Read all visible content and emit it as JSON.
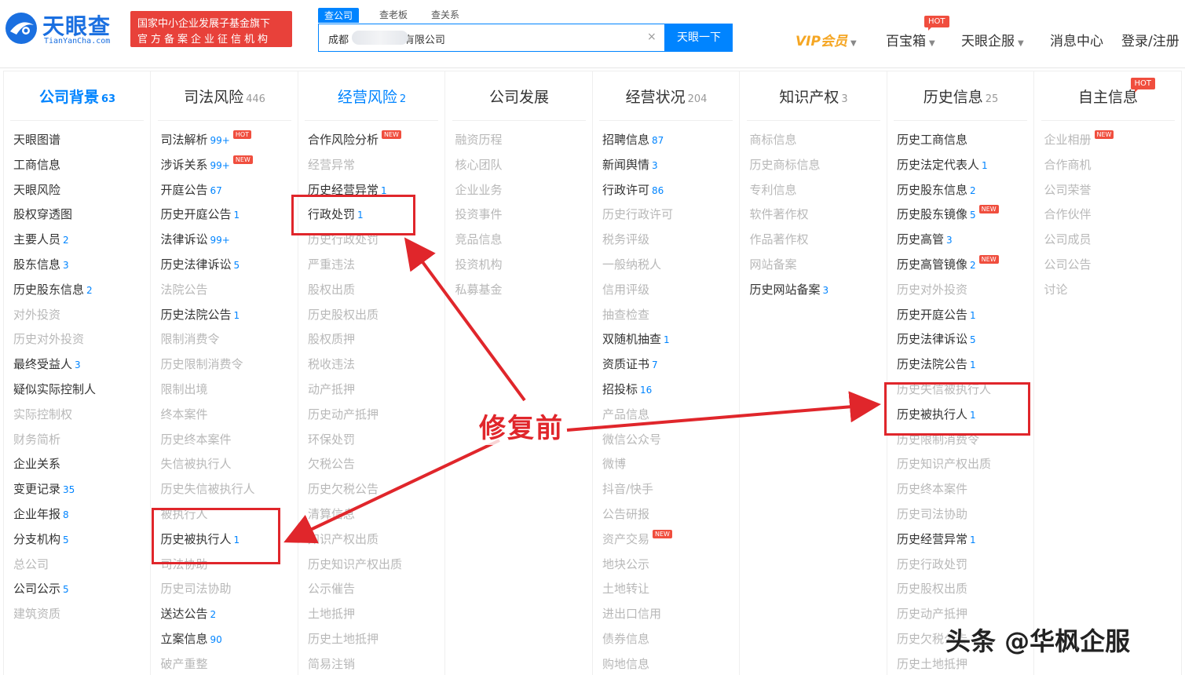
{
  "header": {
    "logo_text": "天眼查",
    "logo_sub": "TianYanCha.com",
    "badge_line1": "国家中小企业发展子基金旗下",
    "badge_line2": "官方备案企业征信机构",
    "search_tabs": [
      "查公司",
      "查老板",
      "查关系"
    ],
    "search_value": "成都              务有限公司",
    "search_button": "天眼一下",
    "clear_icon": "×",
    "nav": {
      "vip": "VIP会员",
      "treasure": "百宝箱",
      "treasure_hot": "HOT",
      "enterprise_service": "天眼企服",
      "messages": "消息中心",
      "login": "登录/注册"
    }
  },
  "columns": [
    {
      "title": "公司背景",
      "count": "63",
      "highlight": true,
      "bold": true,
      "items": [
        {
          "label": "天眼图谱",
          "on": true
        },
        {
          "label": "工商信息",
          "on": true
        },
        {
          "label": "天眼风险",
          "on": true
        },
        {
          "label": "股权穿透图",
          "on": true
        },
        {
          "label": "主要人员",
          "on": true,
          "count": "2"
        },
        {
          "label": "股东信息",
          "on": true,
          "count": "3"
        },
        {
          "label": "历史股东信息",
          "on": true,
          "count": "2"
        },
        {
          "label": "对外投资",
          "on": false
        },
        {
          "label": "历史对外投资",
          "on": false
        },
        {
          "label": "最终受益人",
          "on": true,
          "count": "3"
        },
        {
          "label": "疑似实际控制人",
          "on": true
        },
        {
          "label": "实际控制权",
          "on": false
        },
        {
          "label": "财务简析",
          "on": false
        },
        {
          "label": "企业关系",
          "on": true
        },
        {
          "label": "变更记录",
          "on": true,
          "count": "35"
        },
        {
          "label": "企业年报",
          "on": true,
          "count": "8"
        },
        {
          "label": "分支机构",
          "on": true,
          "count": "5"
        },
        {
          "label": "总公司",
          "on": false
        },
        {
          "label": "公司公示",
          "on": true,
          "count": "5"
        },
        {
          "label": "建筑资质",
          "on": false
        }
      ]
    },
    {
      "title": "司法风险",
      "count": "446",
      "highlight": false,
      "items": [
        {
          "label": "司法解析",
          "on": true,
          "count": "99+",
          "tag": "HOT"
        },
        {
          "label": "涉诉关系",
          "on": true,
          "count": "99+",
          "tag": "NEW"
        },
        {
          "label": "开庭公告",
          "on": true,
          "count": "67"
        },
        {
          "label": "历史开庭公告",
          "on": true,
          "count": "1"
        },
        {
          "label": "法律诉讼",
          "on": true,
          "count": "99+"
        },
        {
          "label": "历史法律诉讼",
          "on": true,
          "count": "5"
        },
        {
          "label": "法院公告",
          "on": false
        },
        {
          "label": "历史法院公告",
          "on": true,
          "count": "1"
        },
        {
          "label": "限制消费令",
          "on": false
        },
        {
          "label": "历史限制消费令",
          "on": false
        },
        {
          "label": "限制出境",
          "on": false
        },
        {
          "label": "终本案件",
          "on": false
        },
        {
          "label": "历史终本案件",
          "on": false
        },
        {
          "label": "失信被执行人",
          "on": false
        },
        {
          "label": "历史失信被执行人",
          "on": false
        },
        {
          "label": "被执行人",
          "on": false
        },
        {
          "label": "历史被执行人",
          "on": true,
          "count": "1"
        },
        {
          "label": "司法协助",
          "on": false
        },
        {
          "label": "历史司法协助",
          "on": false
        },
        {
          "label": "送达公告",
          "on": true,
          "count": "2"
        },
        {
          "label": "立案信息",
          "on": true,
          "count": "90"
        },
        {
          "label": "破产重整",
          "on": false
        }
      ]
    },
    {
      "title": "经营风险",
      "count": "2",
      "highlight": true,
      "items": [
        {
          "label": "合作风险分析",
          "on": true,
          "tag": "NEW"
        },
        {
          "label": "经营异常",
          "on": false
        },
        {
          "label": "历史经营异常",
          "on": true,
          "count": "1"
        },
        {
          "label": "行政处罚",
          "on": true,
          "count": "1"
        },
        {
          "label": "历史行政处罚",
          "on": false
        },
        {
          "label": "严重违法",
          "on": false
        },
        {
          "label": "股权出质",
          "on": false
        },
        {
          "label": "历史股权出质",
          "on": false
        },
        {
          "label": "股权质押",
          "on": false
        },
        {
          "label": "税收违法",
          "on": false
        },
        {
          "label": "动产抵押",
          "on": false
        },
        {
          "label": "历史动产抵押",
          "on": false
        },
        {
          "label": "环保处罚",
          "on": false
        },
        {
          "label": "欠税公告",
          "on": false
        },
        {
          "label": "历史欠税公告",
          "on": false
        },
        {
          "label": "清算信息",
          "on": false
        },
        {
          "label": "知识产权出质",
          "on": false
        },
        {
          "label": "历史知识产权出质",
          "on": false
        },
        {
          "label": "公示催告",
          "on": false
        },
        {
          "label": "土地抵押",
          "on": false
        },
        {
          "label": "历史土地抵押",
          "on": false
        },
        {
          "label": "简易注销",
          "on": false
        }
      ]
    },
    {
      "title": "公司发展",
      "count": "",
      "highlight": false,
      "items": [
        {
          "label": "融资历程",
          "on": false
        },
        {
          "label": "核心团队",
          "on": false
        },
        {
          "label": "企业业务",
          "on": false
        },
        {
          "label": "投资事件",
          "on": false
        },
        {
          "label": "竞品信息",
          "on": false
        },
        {
          "label": "投资机构",
          "on": false
        },
        {
          "label": "私募基金",
          "on": false
        }
      ]
    },
    {
      "title": "经营状况",
      "count": "204",
      "highlight": false,
      "items": [
        {
          "label": "招聘信息",
          "on": true,
          "count": "87"
        },
        {
          "label": "新闻舆情",
          "on": true,
          "count": "3"
        },
        {
          "label": "行政许可",
          "on": true,
          "count": "86"
        },
        {
          "label": "历史行政许可",
          "on": false
        },
        {
          "label": "税务评级",
          "on": false
        },
        {
          "label": "一般纳税人",
          "on": false
        },
        {
          "label": "信用评级",
          "on": false
        },
        {
          "label": "抽查检查",
          "on": false
        },
        {
          "label": "双随机抽查",
          "on": true,
          "count": "1"
        },
        {
          "label": "资质证书",
          "on": true,
          "count": "7"
        },
        {
          "label": "招投标",
          "on": true,
          "count": "16"
        },
        {
          "label": "产品信息",
          "on": false
        },
        {
          "label": "微信公众号",
          "on": false
        },
        {
          "label": "微博",
          "on": false
        },
        {
          "label": "抖音/快手",
          "on": false
        },
        {
          "label": "公告研报",
          "on": false
        },
        {
          "label": "资产交易",
          "on": false,
          "tag": "NEW"
        },
        {
          "label": "地块公示",
          "on": false
        },
        {
          "label": "土地转让",
          "on": false
        },
        {
          "label": "进出口信用",
          "on": false
        },
        {
          "label": "债券信息",
          "on": false
        },
        {
          "label": "购地信息",
          "on": false
        }
      ]
    },
    {
      "title": "知识产权",
      "count": "3",
      "highlight": false,
      "items": [
        {
          "label": "商标信息",
          "on": false
        },
        {
          "label": "历史商标信息",
          "on": false
        },
        {
          "label": "专利信息",
          "on": false
        },
        {
          "label": "软件著作权",
          "on": false
        },
        {
          "label": "作品著作权",
          "on": false
        },
        {
          "label": "网站备案",
          "on": false
        },
        {
          "label": "历史网站备案",
          "on": true,
          "count": "3"
        }
      ]
    },
    {
      "title": "历史信息",
      "count": "25",
      "highlight": false,
      "items": [
        {
          "label": "历史工商信息",
          "on": true
        },
        {
          "label": "历史法定代表人",
          "on": true,
          "count": "1"
        },
        {
          "label": "历史股东信息",
          "on": true,
          "count": "2"
        },
        {
          "label": "历史股东镜像",
          "on": true,
          "count": "5",
          "tag": "NEW"
        },
        {
          "label": "历史高管",
          "on": true,
          "count": "3"
        },
        {
          "label": "历史高管镜像",
          "on": true,
          "count": "2",
          "tag": "NEW"
        },
        {
          "label": "历史对外投资",
          "on": false
        },
        {
          "label": "历史开庭公告",
          "on": true,
          "count": "1"
        },
        {
          "label": "历史法律诉讼",
          "on": true,
          "count": "5"
        },
        {
          "label": "历史法院公告",
          "on": true,
          "count": "1"
        },
        {
          "label": "历史失信被执行人",
          "on": false
        },
        {
          "label": "历史被执行人",
          "on": true,
          "count": "1"
        },
        {
          "label": "历史限制消费令",
          "on": false
        },
        {
          "label": "历史知识产权出质",
          "on": false
        },
        {
          "label": "历史终本案件",
          "on": false
        },
        {
          "label": "历史司法协助",
          "on": false
        },
        {
          "label": "历史经营异常",
          "on": true,
          "count": "1"
        },
        {
          "label": "历史行政处罚",
          "on": false
        },
        {
          "label": "历史股权出质",
          "on": false
        },
        {
          "label": "历史动产抵押",
          "on": false
        },
        {
          "label": "历史欠税公告",
          "on": false
        },
        {
          "label": "历史土地抵押",
          "on": false
        }
      ]
    },
    {
      "title": "自主信息",
      "count": "",
      "highlight": false,
      "title_tag": "HOT",
      "items": [
        {
          "label": "企业相册",
          "on": false,
          "tag": "NEW"
        },
        {
          "label": "合作商机",
          "on": false
        },
        {
          "label": "公司荣誉",
          "on": false
        },
        {
          "label": "合作伙伴",
          "on": false
        },
        {
          "label": "公司成员",
          "on": false
        },
        {
          "label": "公司公告",
          "on": false
        },
        {
          "label": "讨论",
          "on": false
        }
      ]
    }
  ],
  "annotation": {
    "caption": "修复前",
    "arrow_color": "#e0262b"
  },
  "watermark": "头条 @华枫企服",
  "colors": {
    "brand": "#0084ff",
    "accent_red": "#e8413a",
    "vip": "#f5a623",
    "disabled_text": "#b8b8b8"
  }
}
